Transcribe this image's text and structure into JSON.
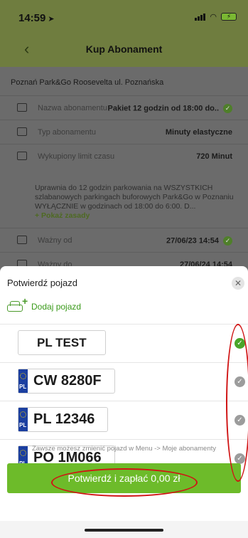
{
  "status": {
    "time": "14:59",
    "location_icon": "location-arrow-icon",
    "battery_icon": "battery-charging-icon"
  },
  "nav": {
    "back_icon": "chevron-left-icon",
    "title": "Kup Abonament"
  },
  "details": {
    "location": "Poznań Park&Go Roosevelta ul. Poznańska",
    "rows": [
      {
        "label": "Nazwa abonamentu",
        "value": "Pakiet 12 godzin od 18:00 do..",
        "icon": "id-card-icon",
        "checked": true
      },
      {
        "label": "Typ abonamentu",
        "value": "Minuty elastyczne",
        "icon": "card-icon",
        "checked": false
      },
      {
        "label": "Wykupiony limit czasu",
        "value": "720 Minut",
        "icon": "hourglass-icon",
        "checked": false
      }
    ],
    "description": "Uprawnia do 12 godzin parkowania na WSZYSTKICH szlabanowych parkingach buforowych Park&Go w Poznaniu WYŁĄCZNIE w godzinach od 18:00 do 6:00. D...",
    "more_label": "+ Pokaż zasady",
    "valid_from": {
      "label": "Ważny od",
      "value": "27/06/23 14:54"
    },
    "valid_to": {
      "label": "Ważny do",
      "value": "27/06/24 14:54"
    }
  },
  "sheet": {
    "title": "Potwierdź pojazd",
    "close_icon": "close-icon",
    "add_vehicle_label": "Dodaj pojazd",
    "vehicles": [
      {
        "plate": "PL TEST",
        "eu_badge": false,
        "country": "",
        "selected": true
      },
      {
        "plate": "CW 8280F",
        "eu_badge": true,
        "country": "PL",
        "selected": false
      },
      {
        "plate": "PL 12346",
        "eu_badge": true,
        "country": "PL",
        "selected": false
      },
      {
        "plate": "PO 1M066",
        "eu_badge": true,
        "country": "PL",
        "selected": false
      }
    ],
    "hint": "Zawsze możesz zmienić pojazd w Menu -> Moje abonamenty",
    "confirm_label": "Potwierdź i zapłać 0,00 zł"
  },
  "colors": {
    "accent_green": "#6dbb2a",
    "annotation_red": "#d01414"
  }
}
